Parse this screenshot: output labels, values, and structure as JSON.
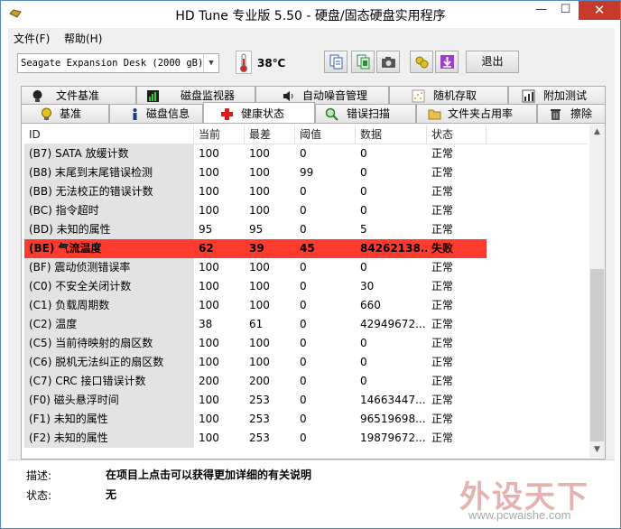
{
  "window": {
    "title": "HD Tune 专业版 5.50 - 硬盘/固态硬盘实用程序",
    "minimize_glyph": "—",
    "maximize_glyph": "☐",
    "close_glyph": "✕"
  },
  "menu": {
    "file": "文件(F)",
    "help": "帮助(H)"
  },
  "toolbar": {
    "drive": "Seagate Expansion Desk (2000 gB)",
    "temperature": "38℃",
    "exit_label": "退出",
    "tool_icons": [
      "copy-info-icon",
      "copy-screen-icon",
      "camera-icon",
      "options-icon",
      "download-icon"
    ]
  },
  "tabs_row1": [
    "文件基准",
    "磁盘监视器",
    "自动噪音管理",
    "随机存取",
    "附加测试"
  ],
  "tabs_row2": [
    "基准",
    "磁盘信息",
    "健康状态",
    "错误扫描",
    "文件夹占用率",
    "擦除"
  ],
  "active_tab": "健康状态",
  "table": {
    "headers": [
      "ID",
      "当前",
      "最差",
      "阈值",
      "数据",
      "状态"
    ],
    "rows": [
      {
        "id": "(B7) SATA 放缓计数",
        "cur": "100",
        "worst": "100",
        "thr": "0",
        "data": "0",
        "status": "正常"
      },
      {
        "id": "(B8) 末尾到末尾错误检测",
        "cur": "100",
        "worst": "100",
        "thr": "99",
        "data": "0",
        "status": "正常"
      },
      {
        "id": "(BB) 无法校正的错误计数",
        "cur": "100",
        "worst": "100",
        "thr": "0",
        "data": "0",
        "status": "正常"
      },
      {
        "id": "(BC) 指令超时",
        "cur": "100",
        "worst": "100",
        "thr": "0",
        "data": "0",
        "status": "正常"
      },
      {
        "id": "(BD) 未知的属性",
        "cur": "95",
        "worst": "95",
        "thr": "0",
        "data": "5",
        "status": "正常"
      },
      {
        "id": "(BE) 气流温度",
        "cur": "62",
        "worst": "39",
        "thr": "45",
        "data": "84262138...",
        "status": "失败",
        "fail": true
      },
      {
        "id": "(BF) 震动侦测错误率",
        "cur": "100",
        "worst": "100",
        "thr": "0",
        "data": "0",
        "status": "正常"
      },
      {
        "id": "(C0) 不安全关闭计数",
        "cur": "100",
        "worst": "100",
        "thr": "0",
        "data": "30",
        "status": "正常"
      },
      {
        "id": "(C1) 负载周期数",
        "cur": "100",
        "worst": "100",
        "thr": "0",
        "data": "660",
        "status": "正常"
      },
      {
        "id": "(C2) 温度",
        "cur": "38",
        "worst": "61",
        "thr": "0",
        "data": "42949672...",
        "status": "正常"
      },
      {
        "id": "(C5) 当前待映射的扇区数",
        "cur": "100",
        "worst": "100",
        "thr": "0",
        "data": "0",
        "status": "正常"
      },
      {
        "id": "(C6) 脱机无法纠正的扇区数",
        "cur": "100",
        "worst": "100",
        "thr": "0",
        "data": "0",
        "status": "正常"
      },
      {
        "id": "(C7) CRC 接口错误计数",
        "cur": "200",
        "worst": "200",
        "thr": "0",
        "data": "0",
        "status": "正常"
      },
      {
        "id": "(F0) 磁头悬浮时间",
        "cur": "100",
        "worst": "253",
        "thr": "0",
        "data": "14663447...",
        "status": "正常"
      },
      {
        "id": "(F1) 未知的属性",
        "cur": "100",
        "worst": "253",
        "thr": "0",
        "data": "96519698...",
        "status": "正常"
      },
      {
        "id": "(F2) 未知的属性",
        "cur": "100",
        "worst": "253",
        "thr": "0",
        "data": "19879672...",
        "status": "正常"
      }
    ]
  },
  "description": {
    "desc_label": "描述:",
    "desc_value": "在项目上点击可以获得更加详细的有关说明",
    "status_label": "状态:",
    "status_value": "无"
  },
  "watermark": {
    "text": "外设天下",
    "url": "www.pcwaishe.com"
  },
  "colors": {
    "fail_row": "#ff3b30",
    "window_border": "#5b88c2",
    "close_button": "#c7392b"
  }
}
